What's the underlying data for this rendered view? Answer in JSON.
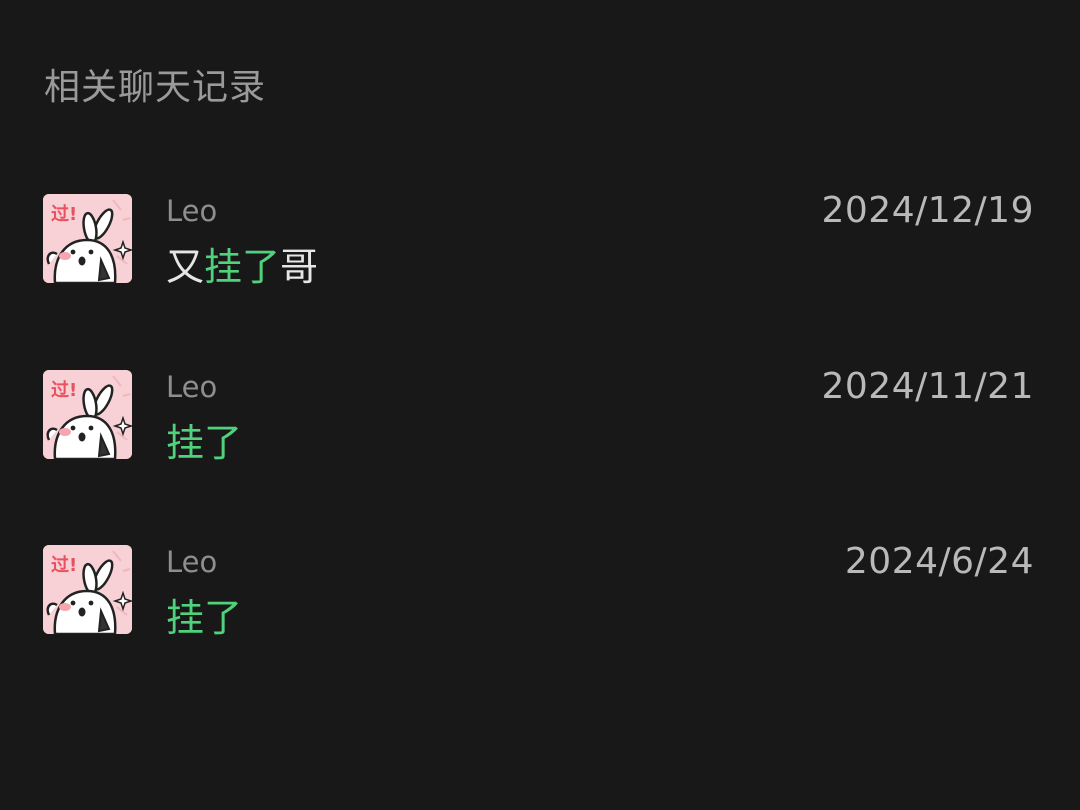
{
  "section": {
    "title": "相关聊天记录"
  },
  "colors": {
    "background": "#181818",
    "highlight": "#4fd27b",
    "text": "#e6e6e6",
    "muted": "#8e8e8e"
  },
  "records": [
    {
      "sender": "Leo",
      "date": "2024/12/19",
      "message": {
        "before": "又",
        "highlight": "挂了",
        "after": "哥"
      },
      "avatar": {
        "icon": "bunny-sticker-icon",
        "badge": "过!"
      }
    },
    {
      "sender": "Leo",
      "date": "2024/11/21",
      "message": {
        "before": "",
        "highlight": "挂了",
        "after": ""
      },
      "avatar": {
        "icon": "bunny-sticker-icon",
        "badge": "过!"
      }
    },
    {
      "sender": "Leo",
      "date": "2024/6/24",
      "message": {
        "before": "",
        "highlight": "挂了",
        "after": ""
      },
      "avatar": {
        "icon": "bunny-sticker-icon",
        "badge": "过!"
      }
    }
  ]
}
